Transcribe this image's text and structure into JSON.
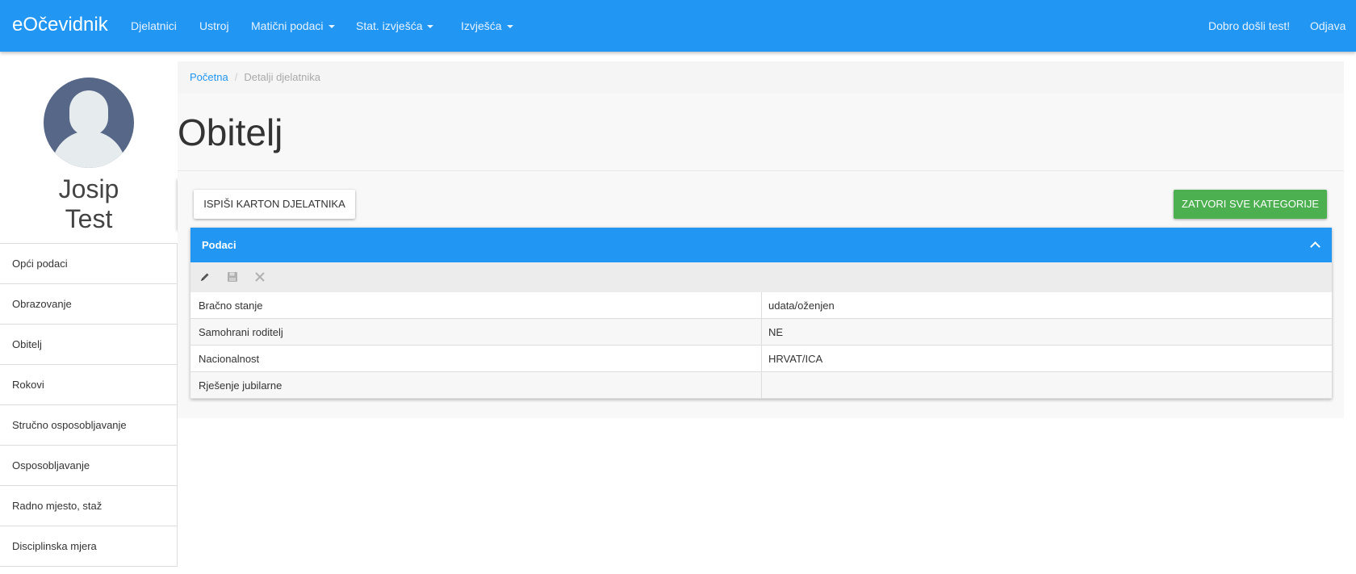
{
  "navbar": {
    "brand": "eOčevidnik",
    "items": [
      {
        "label": "Djelatnici"
      },
      {
        "label": "Ustroj"
      },
      {
        "label": "Matični podaci"
      },
      {
        "label": "Stat. izvješća"
      },
      {
        "label": "Izvješća"
      }
    ],
    "welcome": "Dobro došli test!",
    "logout": "Odjava",
    "color": "#2196f3"
  },
  "user": {
    "first_name": "Josip",
    "last_name": "Test"
  },
  "sidebar": {
    "items": [
      {
        "label": "Opći podaci"
      },
      {
        "label": "Obrazovanje"
      },
      {
        "label": "Obitelj"
      },
      {
        "label": "Rokovi"
      },
      {
        "label": "Stručno osposobljavanje"
      },
      {
        "label": "Osposobljavanje"
      },
      {
        "label": "Radno mjesto, staž"
      },
      {
        "label": "Disciplinska mjera"
      }
    ]
  },
  "breadcrumb": {
    "home": "Početna",
    "current": "Detalji djelatnika"
  },
  "page": {
    "title": "Obitelj"
  },
  "buttons": {
    "print": "ISPIŠI KARTON DJELATNIKA",
    "close_all": "ZATVORI SVE KATEGORIJE",
    "close_all_color": "#4caf50"
  },
  "panel": {
    "title": "Podaci",
    "toolbar_icons": [
      "pencil-icon",
      "save-icon",
      "close-icon"
    ],
    "rows": [
      {
        "key": "Bračno stanje",
        "value": "udata/oženjen"
      },
      {
        "key": "Samohrani roditelj",
        "value": "NE"
      },
      {
        "key": "Nacionalnost",
        "value": "HRVAT/ICA"
      },
      {
        "key": "Rješenje jubilarne",
        "value": ""
      }
    ]
  }
}
